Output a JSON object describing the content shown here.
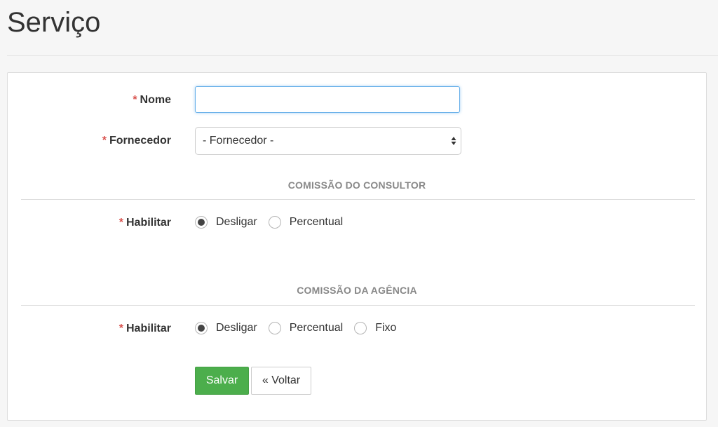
{
  "page": {
    "title": "Serviço"
  },
  "form": {
    "required_mark": "*",
    "nome": {
      "label": "Nome",
      "value": "",
      "placeholder": ""
    },
    "fornecedor": {
      "label": "Fornecedor",
      "selected": "- Fornecedor -"
    }
  },
  "comissao_consultor": {
    "title": "COMISSÃO DO CONSULTOR",
    "habilitar_label": "Habilitar",
    "options": [
      {
        "label": "Desligar",
        "checked": true
      },
      {
        "label": "Percentual",
        "checked": false
      }
    ]
  },
  "comissao_agencia": {
    "title": "COMISSÃO DA AGÊNCIA",
    "habilitar_label": "Habilitar",
    "options": [
      {
        "label": "Desligar",
        "checked": true
      },
      {
        "label": "Percentual",
        "checked": false
      },
      {
        "label": "Fixo",
        "checked": false
      }
    ]
  },
  "actions": {
    "save_label": "Salvar",
    "back_label": "« Voltar"
  },
  "colors": {
    "save_button": "#4cae4c",
    "required": "#d9534f",
    "focus_border": "#66afe9"
  }
}
